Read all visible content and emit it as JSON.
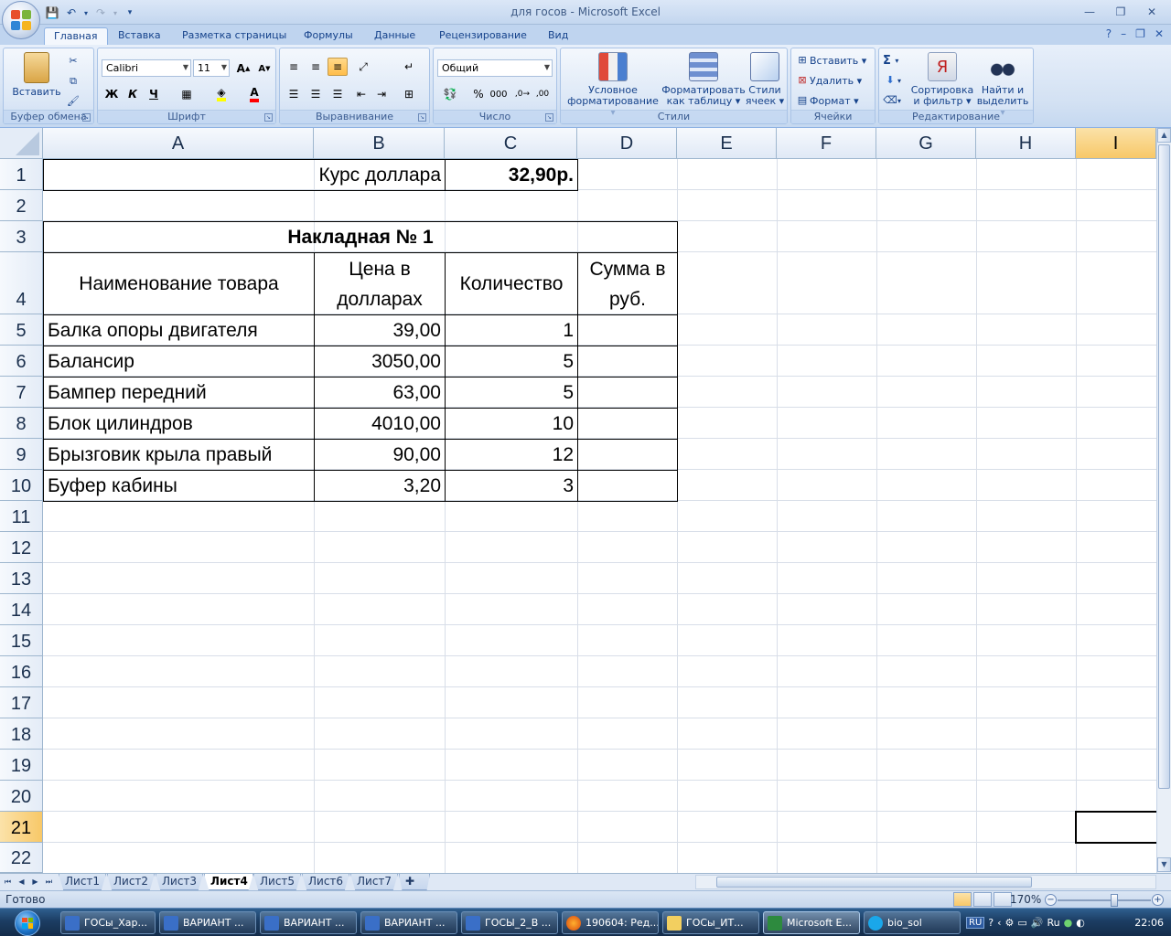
{
  "window": {
    "title": "для госов - Microsoft Excel",
    "controls": {
      "minimize": "—",
      "maximize": "❐",
      "close": "✕"
    },
    "doc_controls": {
      "minimize": "–",
      "restore": "❐",
      "close": "✕"
    }
  },
  "ribbon": {
    "tabs": [
      "Главная",
      "Вставка",
      "Разметка страницы",
      "Формулы",
      "Данные",
      "Рецензирование",
      "Вид"
    ],
    "active_tab": "Главная",
    "clipboard": {
      "label": "Буфер обмена",
      "paste": "Вставить"
    },
    "font": {
      "label": "Шрифт",
      "name": "Calibri",
      "size": "11",
      "bold": "Ж",
      "italic": "К",
      "underline": "Ч",
      "grow": "A",
      "shrink": "A",
      "font_color_glyph": "A"
    },
    "alignment": {
      "label": "Выравнивание"
    },
    "number": {
      "label": "Число",
      "format": "Общий",
      "percent": "%",
      "thousands": "000"
    },
    "styles": {
      "label": "Стили",
      "conditional": [
        "Условное",
        "форматирование"
      ],
      "as_table": [
        "Форматировать",
        "как таблицу"
      ],
      "cell_styles": [
        "Стили",
        "ячеек"
      ]
    },
    "cells": {
      "label": "Ячейки",
      "insert": "Вставить",
      "delete": "Удалить",
      "format": "Формат"
    },
    "editing": {
      "label": "Редактирование",
      "sort": [
        "Сортировка",
        "и фильтр"
      ],
      "find": [
        "Найти и",
        "выделить"
      ],
      "sum_glyph": "Σ"
    }
  },
  "grid": {
    "columns": [
      "A",
      "B",
      "C",
      "D",
      "E",
      "F",
      "G",
      "H",
      "I"
    ],
    "selected_column": "I",
    "rows": [
      "1",
      "2",
      "3",
      "4",
      "5",
      "6",
      "7",
      "8",
      "9",
      "10",
      "11",
      "12",
      "13",
      "14",
      "15",
      "16",
      "17",
      "18",
      "19",
      "20",
      "21",
      "22"
    ],
    "selected_row": "21",
    "cells": {
      "B1": "Курс доллара",
      "C1": "32,90р.",
      "A3": "Накладная № 1",
      "A4": "Наименование  товара",
      "B4": [
        "Цена в",
        "долларах"
      ],
      "C4": "Количество",
      "D4": [
        "Сумма в",
        "руб."
      ],
      "items": [
        {
          "name": "Балка опоры двигателя",
          "price": "39,00",
          "qty": "1"
        },
        {
          "name": "Балансир",
          "price": "3050,00",
          "qty": "5"
        },
        {
          "name": "Бампер передний",
          "price": "63,00",
          "qty": "5"
        },
        {
          "name": "Блок цилиндров",
          "price": "4010,00",
          "qty": "10"
        },
        {
          "name": "Брызговик крыла правый",
          "price": "90,00",
          "qty": "12"
        },
        {
          "name": "Буфер кабины",
          "price": "3,20",
          "qty": "3"
        }
      ]
    }
  },
  "sheets": {
    "tabs": [
      "Лист1",
      "Лист2",
      "Лист3",
      "Лист4",
      "Лист5",
      "Лист6",
      "Лист7"
    ],
    "active": "Лист4"
  },
  "status": {
    "text": "Готово",
    "zoom": "170%"
  },
  "taskbar": {
    "items": [
      "ГОСы_Хар...",
      "ВАРИАНТ ...",
      "ВАРИАНТ ...",
      "ВАРИАНТ ...",
      "ГОСЫ_2_В ...",
      "190604: Ред...",
      "ГОСы_ИТ...",
      "Microsoft E...",
      "bio_sol"
    ],
    "active": "Microsoft E...",
    "lang": "RU",
    "lang2": "Ru",
    "time": "22:06"
  }
}
